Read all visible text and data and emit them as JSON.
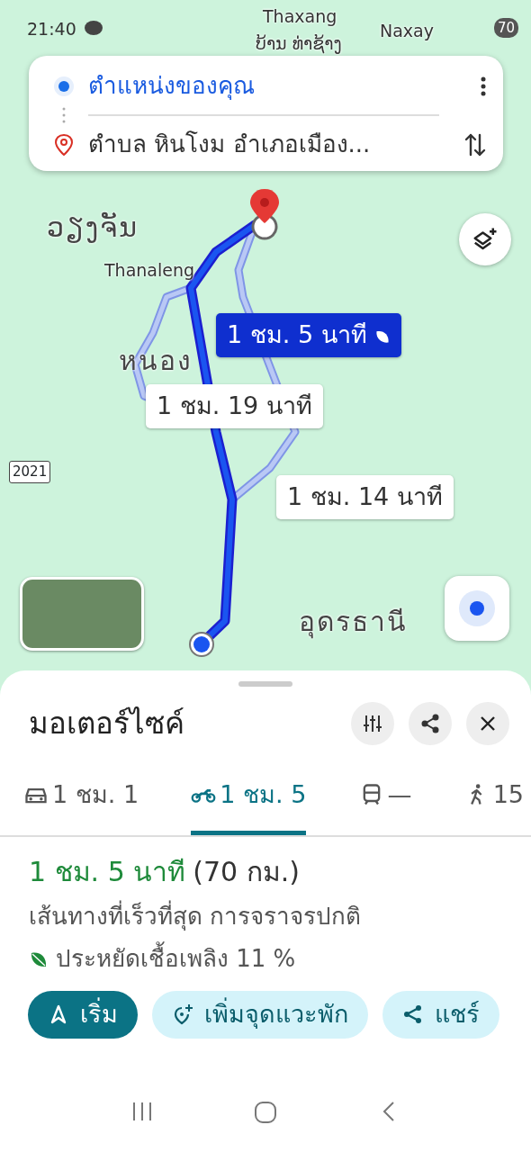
{
  "status_bar": {
    "time": "21:40",
    "battery": "70"
  },
  "map": {
    "labels": [
      {
        "text": "Thaxang",
        "kind": "place"
      },
      {
        "text": "ບ້ານ ທ່າຊ້າງ",
        "kind": "place"
      },
      {
        "text": "Naxay",
        "kind": "place"
      },
      {
        "text": "ວຽງຈັນ",
        "kind": "city"
      },
      {
        "text": "Thanaleng",
        "kind": "place"
      },
      {
        "text": "หนอง",
        "kind": "city"
      },
      {
        "text": "อุดรธานี",
        "kind": "city"
      },
      {
        "text": "2021",
        "kind": "road"
      }
    ],
    "routes": [
      {
        "text": "1 ชม. 5 นาที",
        "selected": true,
        "eco": true
      },
      {
        "text": "1 ชม. 19 นาที",
        "selected": false,
        "eco": false
      },
      {
        "text": "1 ชม. 14 นาที",
        "selected": false,
        "eco": false
      }
    ]
  },
  "search": {
    "origin": "ตำแหน่งของคุณ",
    "destination": "ตำบล หินโงม อำเภอเมือง..."
  },
  "sheet": {
    "title": "มอเตอร์ไซค์",
    "modes": [
      {
        "kind": "car",
        "text": "1 ชม. 1",
        "selected": false
      },
      {
        "kind": "motorcycle",
        "text": "1 ชม. 5",
        "selected": true
      },
      {
        "kind": "transit",
        "text": "—",
        "selected": false
      },
      {
        "kind": "walk",
        "text": "15",
        "selected": false
      }
    ],
    "duration": "1 ชม. 5 นาที",
    "distance": "(70 กม.)",
    "description": "เส้นทางที่เร็วที่สุด การจราจรปกติ",
    "eco": "ประหยัดเชื้อเพลิง 11 %",
    "actions": [
      {
        "kind": "start",
        "text": "เริ่ม"
      },
      {
        "kind": "stop",
        "text": "เพิ่มจุดแวะพัก"
      },
      {
        "kind": "share",
        "text": "แชร์"
      }
    ]
  }
}
